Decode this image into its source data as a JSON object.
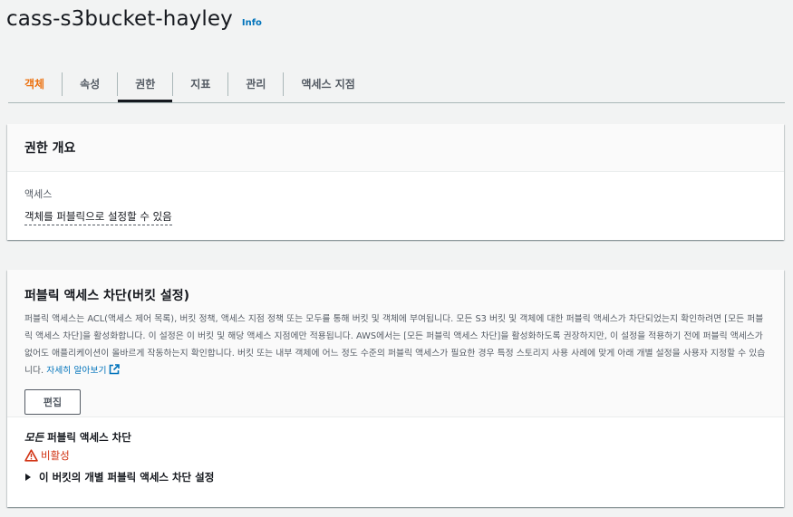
{
  "header": {
    "title": "cass-s3bucket-hayley",
    "info_label": "Info"
  },
  "tabs": [
    {
      "label": "객체",
      "active": true
    },
    {
      "label": "속성"
    },
    {
      "label": "권한",
      "selected": true
    },
    {
      "label": "지표"
    },
    {
      "label": "관리"
    },
    {
      "label": "액세스 지점"
    }
  ],
  "permissions_overview": {
    "title": "권한 개요",
    "access_label": "액세스",
    "access_value": "객체를 퍼블릭으로 설정할 수 있음"
  },
  "block_public_access": {
    "title": "퍼블릭 액세스 차단(버킷 설정)",
    "description": "퍼블릭 액세스는 ACL(액세스 제어 목록), 버킷 정책, 액세스 지점 정책 또는 모두를 통해 버킷 및 객체에 부여됩니다. 모든 S3 버킷 및 객체에 대한 퍼블릭 액세스가 차단되었는지 확인하려면 [모든 퍼블릭 액세스 차단]을 활성화합니다. 이 설정은 이 버킷 및 해당 액세스 지점에만 적용됩니다. AWS에서는 [모든 퍼블릭 액세스 차단]을 활성화하도록 권장하지만, 이 설정을 적용하기 전에 퍼블릭 액세스가 없어도 애플리케이션이 올바르게 작동하는지 확인합니다. 버킷 또는 내부 객체에 어느 정도 수준의 퍼블릭 액세스가 필요한 경우 특정 스토리지 사용 사례에 맞게 아래 개별 설정을 사용자 지정할 수 있습니다.",
    "learn_more": "자세히 알아보기",
    "edit_button": "편집",
    "block_all_emphasis": "모든",
    "block_all_rest": " 퍼블릭 액세스 차단",
    "status": "비활성",
    "expander_label": "이 버킷의 개별 퍼블릭 액세스 차단 설정"
  },
  "colors": {
    "accent_orange": "#ec7211",
    "link_blue": "#0073bb",
    "error_red": "#d13212"
  }
}
